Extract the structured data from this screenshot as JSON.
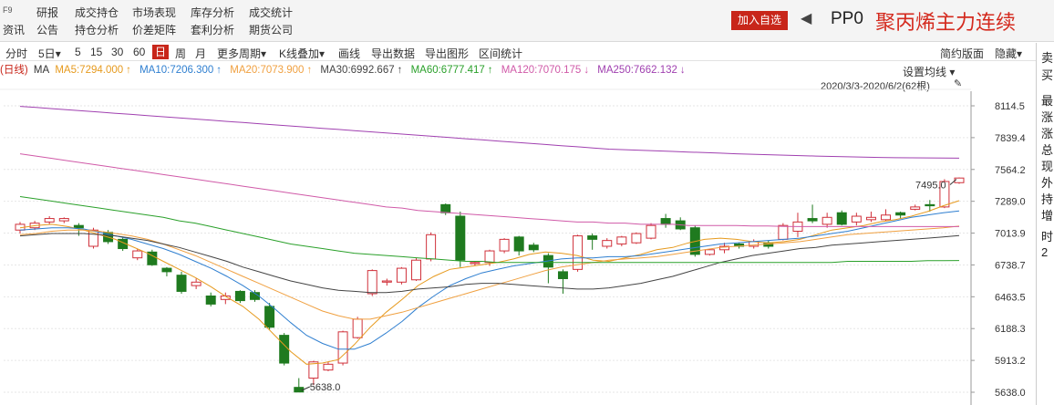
{
  "topbar": {
    "f9": "F9",
    "zixun": "资讯",
    "nav": [
      "研报",
      "公告",
      "成交持仓",
      "持仓分析",
      "市场表现",
      "价差矩阵",
      "库存分析",
      "套利分析",
      "成交统计",
      "期货公司"
    ],
    "add_button": "加入自选",
    "code": "PP0",
    "title": "聚丙烯主力连续"
  },
  "toolbar": {
    "items": [
      "分时",
      "5日",
      "5",
      "15",
      "30",
      "60",
      "日",
      "周",
      "月",
      "更多周期",
      "K线叠加",
      "画线",
      "导出数据",
      "导出图形",
      "区间统计"
    ],
    "active": "日",
    "chevron": "▾",
    "right": [
      "简约版面",
      "隐藏"
    ]
  },
  "ma_row": {
    "prefix": "(日线)",
    "ma_label": "MA",
    "items": [
      {
        "label": "MA5:7294.000",
        "arrow": "↑",
        "color": "#e69a1e"
      },
      {
        "label": "MA10:7206.300",
        "arrow": "↑",
        "color": "#2f7fd0"
      },
      {
        "label": "MA20:7073.900",
        "arrow": "↑",
        "color": "#f0a040"
      },
      {
        "label": "MA30:6992.667",
        "arrow": "↑",
        "color": "#444444"
      },
      {
        "label": "MA60:6777.417",
        "arrow": "↑",
        "color": "#2aa02a"
      },
      {
        "label": "MA120:7070.175",
        "arrow": "↓",
        "color": "#d05aa8"
      },
      {
        "label": "MA250:7662.132",
        "arrow": "↓",
        "color": "#a040b0"
      }
    ]
  },
  "chart_header": {
    "set_ma": "设置均线 ▾",
    "range": "2020/3/3-2020/6/2(62根)",
    "pin": "📌"
  },
  "side": {
    "top": [
      "卖",
      "买"
    ],
    "mid": [
      "最",
      "涨",
      "涨",
      "总",
      "现",
      "外",
      "持",
      "增"
    ],
    "bottom": [
      "时",
      "2"
    ]
  },
  "chart_data": {
    "type": "candlestick",
    "y_ticks": [
      8114.5,
      7839.4,
      7564.2,
      7289.0,
      7013.9,
      6738.7,
      6463.5,
      6188.3,
      5913.2,
      5638.0
    ],
    "ylim": [
      5638.0,
      8114.5
    ],
    "annotations": {
      "high_label": "7495.0",
      "low_label": "5638.0"
    },
    "up_color": "#d0303a",
    "down_color": "#1f7a1f",
    "candles": [
      [
        7040,
        7090,
        7010,
        7110
      ],
      [
        7060,
        7100,
        7040,
        7120
      ],
      [
        7110,
        7140,
        7090,
        7160
      ],
      [
        7120,
        7140,
        7100,
        7150
      ],
      [
        7080,
        7060,
        6990,
        7100
      ],
      [
        6900,
        7040,
        6880,
        7060
      ],
      [
        7020,
        6940,
        6920,
        7040
      ],
      [
        6960,
        6880,
        6860,
        6980
      ],
      [
        6800,
        6860,
        6780,
        6880
      ],
      [
        6850,
        6740,
        6730,
        6870
      ],
      [
        6710,
        6680,
        6640,
        6720
      ],
      [
        6650,
        6510,
        6490,
        6680
      ],
      [
        6560,
        6590,
        6530,
        6620
      ],
      [
        6470,
        6400,
        6380,
        6500
      ],
      [
        6440,
        6470,
        6400,
        6500
      ],
      [
        6510,
        6430,
        6410,
        6520
      ],
      [
        6500,
        6440,
        6420,
        6520
      ],
      [
        6380,
        6200,
        6180,
        6410
      ],
      [
        6130,
        5890,
        5870,
        6150
      ],
      [
        5680,
        5640,
        5638,
        5760
      ],
      [
        5760,
        5900,
        5700,
        5910
      ],
      [
        5830,
        5880,
        5820,
        5900
      ],
      [
        5890,
        6160,
        5870,
        6170
      ],
      [
        6110,
        6270,
        6100,
        6290
      ],
      [
        6490,
        6690,
        6470,
        6700
      ],
      [
        6590,
        6600,
        6560,
        6620
      ],
      [
        6590,
        6710,
        6570,
        6720
      ],
      [
        6610,
        6780,
        6600,
        6800
      ],
      [
        6790,
        7000,
        6770,
        7020
      ],
      [
        7260,
        7190,
        7170,
        7270
      ],
      [
        7160,
        6780,
        6720,
        7200
      ],
      [
        6750,
        6760,
        6730,
        6770
      ],
      [
        6760,
        6860,
        6730,
        6870
      ],
      [
        6860,
        6960,
        6840,
        6970
      ],
      [
        6980,
        6860,
        6820,
        6990
      ],
      [
        6910,
        6870,
        6850,
        6930
      ],
      [
        6820,
        6720,
        6580,
        6840
      ],
      [
        6680,
        6620,
        6490,
        6700
      ],
      [
        6700,
        6990,
        6680,
        7000
      ],
      [
        6990,
        6960,
        6870,
        7010
      ],
      [
        6900,
        6950,
        6880,
        6970
      ],
      [
        6920,
        6980,
        6900,
        6990
      ],
      [
        6930,
        7010,
        6920,
        7020
      ],
      [
        6970,
        7080,
        6960,
        7100
      ],
      [
        7140,
        7090,
        7060,
        7180
      ],
      [
        7120,
        7050,
        7040,
        7150
      ],
      [
        7060,
        6830,
        6810,
        7080
      ],
      [
        6830,
        6870,
        6820,
        6880
      ],
      [
        6870,
        6900,
        6840,
        6930
      ],
      [
        6920,
        6900,
        6880,
        6930
      ],
      [
        6900,
        6940,
        6880,
        6960
      ],
      [
        6930,
        6900,
        6880,
        6950
      ],
      [
        6960,
        7080,
        6950,
        7100
      ],
      [
        7030,
        7110,
        6980,
        7190
      ],
      [
        7140,
        7120,
        7100,
        7260
      ],
      [
        7090,
        7150,
        7060,
        7190
      ],
      [
        7190,
        7090,
        7080,
        7210
      ],
      [
        7110,
        7160,
        7080,
        7190
      ],
      [
        7130,
        7150,
        7110,
        7200
      ],
      [
        7130,
        7170,
        7120,
        7220
      ],
      [
        7190,
        7170,
        7140,
        7200
      ],
      [
        7220,
        7240,
        7210,
        7260
      ],
      [
        7260,
        7250,
        7200,
        7300
      ],
      [
        7240,
        7460,
        7230,
        7480
      ],
      [
        7450,
        7490,
        7440,
        7495
      ]
    ],
    "ma_series": [
      {
        "name": "MA5",
        "color": "#e69a1e",
        "values": [
          7060,
          7080,
          7090,
          7070,
          7040,
          7000,
          6960,
          6900,
          6840,
          6770,
          6700,
          6630,
          6550,
          6460,
          6380,
          6270,
          6130,
          5990,
          5880,
          5890,
          5920,
          6050,
          6200,
          6330,
          6440,
          6560,
          6640,
          6700,
          6720,
          6740,
          6760,
          6790,
          6830,
          6850,
          6840,
          6820,
          6780,
          6770,
          6800,
          6830,
          6870,
          6890,
          6930,
          6960,
          6970,
          6960,
          6940,
          6930,
          6940,
          6960,
          7000,
          7040,
          7060,
          7080,
          7110,
          7130,
          7160,
          7200,
          7250,
          7294
        ]
      },
      {
        "name": "MA10",
        "color": "#2f7fd0",
        "values": [
          7040,
          7050,
          7060,
          7060,
          7050,
          7020,
          6990,
          6960,
          6920,
          6880,
          6830,
          6770,
          6710,
          6640,
          6560,
          6470,
          6360,
          6240,
          6130,
          6060,
          6010,
          6010,
          6060,
          6150,
          6250,
          6370,
          6470,
          6560,
          6620,
          6670,
          6700,
          6730,
          6750,
          6770,
          6790,
          6800,
          6800,
          6810,
          6810,
          6820,
          6840,
          6860,
          6880,
          6900,
          6920,
          6930,
          6940,
          6950,
          6960,
          6970,
          6990,
          7010,
          7030,
          7060,
          7090,
          7120,
          7150,
          7170,
          7190,
          7206
        ]
      },
      {
        "name": "MA20",
        "color": "#f0a040",
        "values": [
          7000,
          7010,
          7030,
          7040,
          7040,
          7030,
          7010,
          6990,
          6960,
          6920,
          6870,
          6820,
          6760,
          6700,
          6640,
          6580,
          6520,
          6460,
          6400,
          6340,
          6300,
          6270,
          6270,
          6300,
          6330,
          6370,
          6410,
          6450,
          6490,
          6530,
          6570,
          6610,
          6650,
          6690,
          6720,
          6740,
          6760,
          6780,
          6790,
          6800,
          6810,
          6830,
          6850,
          6870,
          6890,
          6900,
          6910,
          6920,
          6930,
          6940,
          6960,
          6980,
          7000,
          7010,
          7020,
          7030,
          7040,
          7050,
          7060,
          7074
        ]
      },
      {
        "name": "MA30",
        "color": "#444444",
        "values": [
          6990,
          7000,
          7010,
          7010,
          7010,
          7000,
          6990,
          6970,
          6950,
          6920,
          6890,
          6850,
          6810,
          6770,
          6720,
          6680,
          6640,
          6600,
          6570,
          6540,
          6520,
          6510,
          6500,
          6500,
          6510,
          6530,
          6540,
          6550,
          6570,
          6580,
          6580,
          6570,
          6560,
          6550,
          6540,
          6530,
          6530,
          6540,
          6560,
          6580,
          6610,
          6640,
          6680,
          6720,
          6760,
          6790,
          6820,
          6840,
          6860,
          6880,
          6890,
          6910,
          6920,
          6930,
          6940,
          6950,
          6960,
          6970,
          6980,
          6993
        ]
      },
      {
        "name": "MA60",
        "color": "#2aa02a",
        "values": [
          7330,
          7310,
          7290,
          7270,
          7250,
          7230,
          7210,
          7190,
          7170,
          7150,
          7120,
          7100,
          7070,
          7040,
          7010,
          6980,
          6950,
          6920,
          6900,
          6880,
          6860,
          6840,
          6830,
          6820,
          6810,
          6800,
          6790,
          6780,
          6770,
          6770,
          6760,
          6760,
          6760,
          6760,
          6760,
          6760,
          6760,
          6760,
          6760,
          6760,
          6760,
          6760,
          6760,
          6760,
          6760,
          6760,
          6760,
          6760,
          6760,
          6760,
          6760,
          6760,
          6770,
          6770,
          6770,
          6770,
          6770,
          6775,
          6776,
          6777
        ]
      },
      {
        "name": "MA120",
        "color": "#d05aa8",
        "values": [
          7700,
          7680,
          7660,
          7640,
          7620,
          7600,
          7580,
          7560,
          7540,
          7520,
          7500,
          7480,
          7460,
          7440,
          7420,
          7400,
          7380,
          7360,
          7340,
          7320,
          7300,
          7280,
          7260,
          7240,
          7230,
          7210,
          7200,
          7190,
          7180,
          7170,
          7160,
          7150,
          7140,
          7130,
          7120,
          7110,
          7110,
          7100,
          7100,
          7090,
          7090,
          7090,
          7080,
          7080,
          7080,
          7080,
          7075,
          7075,
          7072,
          7070,
          7070,
          7070,
          7070,
          7070,
          7070,
          7070,
          7070,
          7070,
          7070,
          7070
        ]
      },
      {
        "name": "MA250",
        "color": "#a040b0",
        "values": [
          8110,
          8100,
          8090,
          8080,
          8070,
          8060,
          8050,
          8040,
          8030,
          8020,
          8010,
          8000,
          7990,
          7980,
          7970,
          7960,
          7950,
          7940,
          7930,
          7920,
          7910,
          7900,
          7890,
          7880,
          7870,
          7860,
          7850,
          7840,
          7830,
          7820,
          7810,
          7800,
          7790,
          7780,
          7770,
          7760,
          7750,
          7740,
          7735,
          7730,
          7725,
          7720,
          7715,
          7710,
          7705,
          7700,
          7696,
          7692,
          7688,
          7684,
          7680,
          7677,
          7674,
          7671,
          7668,
          7666,
          7665,
          7664,
          7663,
          7662
        ]
      }
    ]
  }
}
